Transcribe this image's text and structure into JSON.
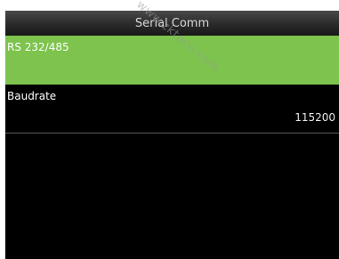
{
  "header": {
    "title": "Serial Comm"
  },
  "menu": {
    "items": [
      {
        "label": "RS 232/485",
        "value": ""
      },
      {
        "label": "Baudrate",
        "value": "115200"
      }
    ]
  },
  "watermark": {
    "text": "www.zkteco.com"
  },
  "colors": {
    "selected_bg": "#7dc34d",
    "screen_bg": "#000000",
    "text": "#ffffff"
  }
}
